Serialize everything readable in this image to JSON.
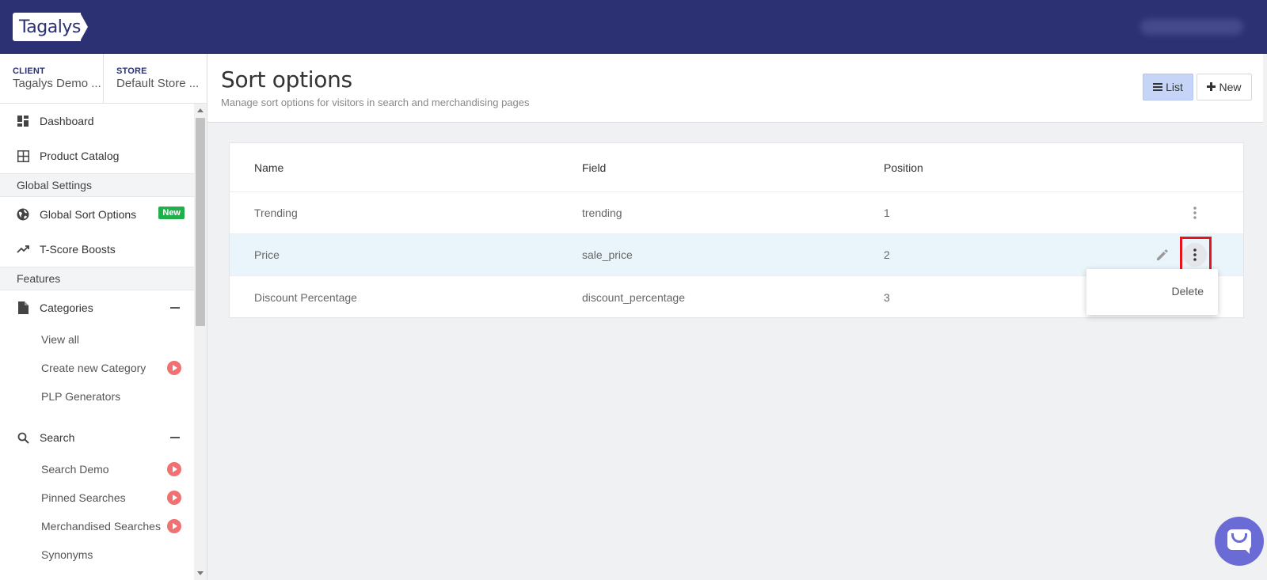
{
  "app": {
    "logo_text": "Tagalys"
  },
  "scope": {
    "client_label": "CLIENT",
    "client_value": "Tagalys Demo ...",
    "store_label": "STORE",
    "store_value": "Default Store ..."
  },
  "sidebar": {
    "dashboard": "Dashboard",
    "product_catalog": "Product Catalog",
    "global_settings": "Global Settings",
    "global_sort_options": "Global Sort Options",
    "new_badge": "New",
    "tscore_boosts": "T-Score Boosts",
    "features": "Features",
    "categories": "Categories",
    "view_all": "View all",
    "create_new_category": "Create new Category",
    "plp_generators": "PLP Generators",
    "search": "Search",
    "search_demo": "Search Demo",
    "pinned_searches": "Pinned Searches",
    "merchandised_searches": "Merchandised Searches",
    "synonyms": "Synonyms"
  },
  "header": {
    "title": "Sort options",
    "subtitle": "Manage sort options for visitors in search and merchandising pages",
    "list_button": "List",
    "new_button": "New"
  },
  "table": {
    "columns": [
      "Name",
      "Field",
      "Position"
    ],
    "rows": [
      {
        "name": "Trending",
        "field": "trending",
        "position": "1"
      },
      {
        "name": "Price",
        "field": "sale_price",
        "position": "2"
      },
      {
        "name": "Discount Percentage",
        "field": "discount_percentage",
        "position": "3"
      }
    ]
  },
  "dropdown": {
    "delete": "Delete"
  },
  "colors": {
    "topbar": "#2b3173",
    "accent_new": "#20b04b",
    "play_dot": "#f07171",
    "highlight": "#e8141b",
    "chat": "#6b6bd6"
  }
}
